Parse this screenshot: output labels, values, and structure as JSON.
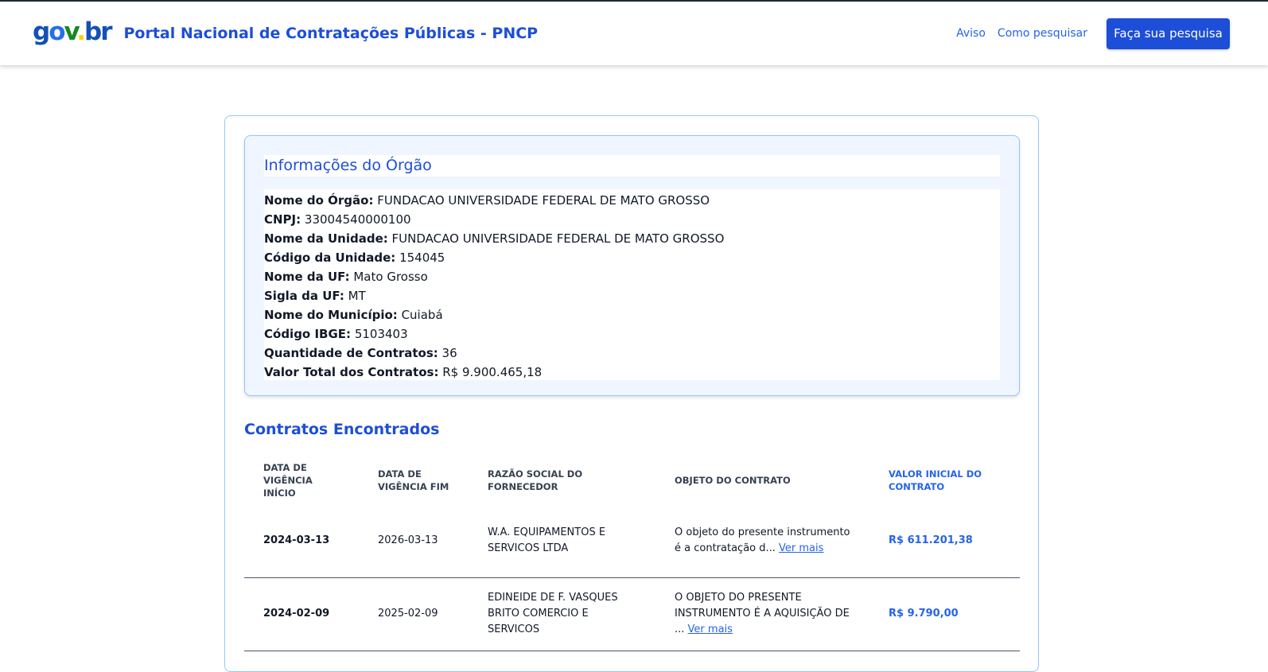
{
  "header": {
    "logo": {
      "g": "g",
      "o": "o",
      "v": "v",
      "dot": ".",
      "b": "b",
      "r": "r"
    },
    "title": "Portal Nacional de Contratações Públicas - PNCP",
    "nav": [
      "Aviso",
      "Como pesquisar"
    ],
    "search_button": "Faça sua pesquisa"
  },
  "orgao": {
    "title": "Informações do Órgão",
    "fields": [
      {
        "label": "Nome do Órgão:",
        "value": "FUNDACAO UNIVERSIDADE FEDERAL DE MATO GROSSO"
      },
      {
        "label": "CNPJ:",
        "value": "33004540000100"
      },
      {
        "label": "Nome da Unidade:",
        "value": "FUNDACAO UNIVERSIDADE FEDERAL DE MATO GROSSO"
      },
      {
        "label": "Código da Unidade:",
        "value": "154045"
      },
      {
        "label": "Nome da UF:",
        "value": "Mato Grosso"
      },
      {
        "label": "Sigla da UF:",
        "value": "MT"
      },
      {
        "label": "Nome do Município:",
        "value": "Cuiabá"
      },
      {
        "label": "Código IBGE:",
        "value": "5103403"
      },
      {
        "label": "Quantidade de Contratos:",
        "value": "36"
      },
      {
        "label": "Valor Total dos Contratos:",
        "value": "R$ 9.900.465,18"
      }
    ]
  },
  "contratos": {
    "title": "Contratos Encontrados",
    "columns": [
      "DATA DE VIGÊNCIA INÍCIO",
      "DATA DE VIGÊNCIA FIM",
      "RAZÃO SOCIAL DO FORNECEDOR",
      "OBJETO DO CONTRATO",
      "VALOR INICIAL DO CONTRATO"
    ],
    "ver_mais": "Ver mais",
    "rows": [
      {
        "inicio": "2024-03-13",
        "fim": "2026-03-13",
        "fornecedor": "W.A. EQUIPAMENTOS E SERVICOS LTDA",
        "objeto": "O objeto do presente instrumento é a contratação d...",
        "valor": "R$ 611.201,38"
      },
      {
        "inicio": "2024-02-09",
        "fim": "2025-02-09",
        "fornecedor": "EDINEIDE DE F. VASQUES BRITO COMERCIO E SERVICOS",
        "objeto": "O OBJETO DO PRESENTE INSTRUMENTO É A AQUISIÇÃO DE ...",
        "valor": "R$ 9.790,00"
      }
    ]
  },
  "colors": {
    "primary": "#1d4ed8",
    "link": "#2563eb",
    "card_bg": "#eff6ff",
    "card_border": "#93c5fd"
  }
}
